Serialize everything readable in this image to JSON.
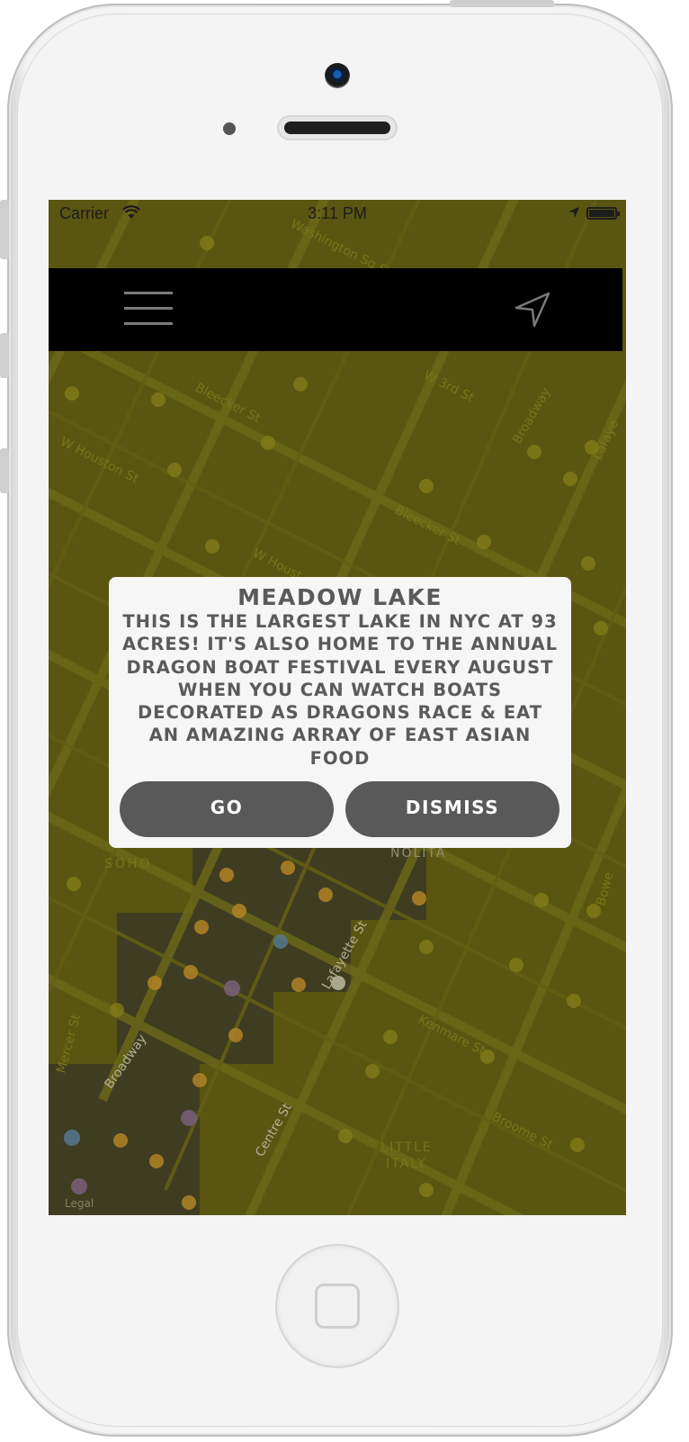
{
  "status_bar": {
    "carrier": "Carrier",
    "time": "3:11 PM"
  },
  "nav_bar": {
    "menu_icon": "hamburger-menu-icon",
    "location_icon": "navigation-arrow-icon"
  },
  "map": {
    "labels": [
      "Washington Sq S",
      "W 3rd St",
      "Broadway",
      "Bleecker St",
      "W Houston St",
      "Bleecker St",
      "W Houst",
      "Lafaye",
      "SOHO",
      "NOLITA",
      "Lafayette St",
      "Kenmare St",
      "Broadway",
      "Mercer St",
      "Centre St",
      "Broome St",
      "Bowe",
      "LITTLE ITALY",
      "Legal"
    ],
    "tint_color": "#6e6a10"
  },
  "modal": {
    "title": "Meadow Lake",
    "body": "This is the largest lake in NYC at 93 acres! It's also home to the annual Dragon Boat Festival every August when you can watch boats decorated as dragons race & eat an amazing array of East Asian food",
    "go_label": "Go",
    "dismiss_label": "Dismiss"
  }
}
